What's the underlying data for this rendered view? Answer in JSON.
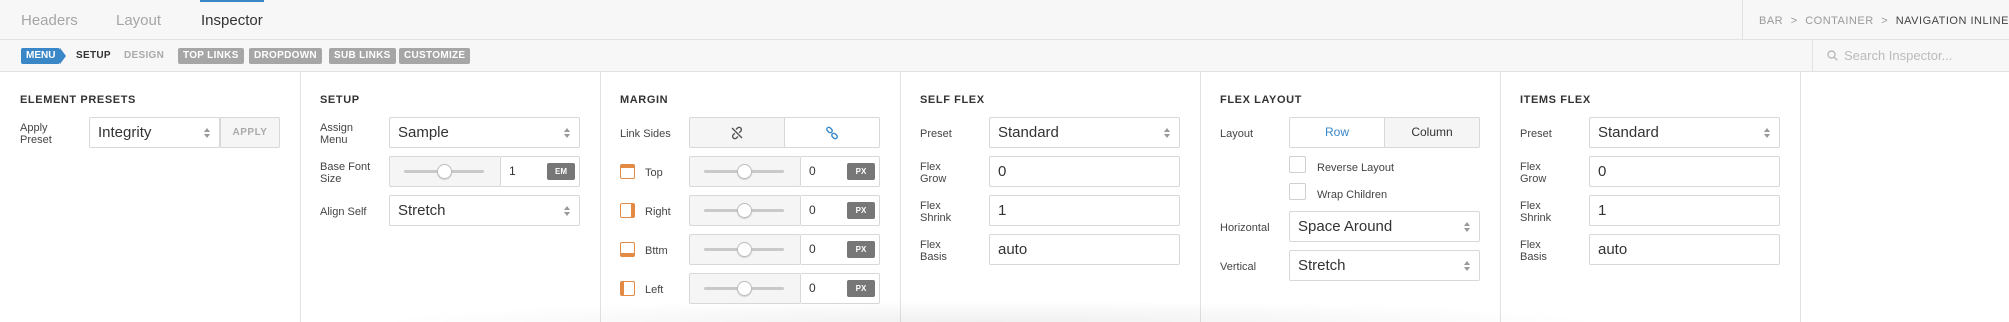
{
  "tabs": [
    "Headers",
    "Layout",
    "Inspector"
  ],
  "breadcrumb": {
    "items": [
      "BAR",
      "CONTAINER",
      "NAVIGATION INLINE"
    ],
    "sep": ">"
  },
  "subnav": {
    "menu": "MENU",
    "setup": "SETUP",
    "design": "DESIGN",
    "tags": [
      "TOP LINKS",
      "DROPDOWN",
      "SUB LINKS",
      "CUSTOMIZE"
    ]
  },
  "search": {
    "placeholder": "Search Inspector..."
  },
  "element_presets": {
    "title": "ELEMENT PRESETS",
    "apply_label": "Apply\nPreset",
    "preset_value": "Integrity",
    "apply_button": "APPLY"
  },
  "setup": {
    "title": "SETUP",
    "assign_menu_label": "Assign\nMenu",
    "assign_menu_value": "Sample",
    "base_font_label": "Base Font\nSize",
    "base_font_value": "1",
    "base_font_unit": "EM",
    "base_font_slider": 0.5,
    "align_self_label": "Align Self",
    "align_self_value": "Stretch"
  },
  "margin": {
    "title": "MARGIN",
    "link_sides_label": "Link Sides",
    "sides": [
      {
        "label": "Top",
        "value": "0",
        "unit": "PX",
        "slider": 0.5
      },
      {
        "label": "Right",
        "value": "0",
        "unit": "PX",
        "slider": 0.5
      },
      {
        "label": "Bttm",
        "value": "0",
        "unit": "PX",
        "slider": 0.5
      },
      {
        "label": "Left",
        "value": "0",
        "unit": "PX",
        "slider": 0.5
      }
    ]
  },
  "self_flex": {
    "title": "SELF FLEX",
    "preset_label": "Preset",
    "preset_value": "Standard",
    "grow_label": "Flex\nGrow",
    "grow_value": "0",
    "shrink_label": "Flex\nShrink",
    "shrink_value": "1",
    "basis_label": "Flex\nBasis",
    "basis_value": "auto"
  },
  "flex_layout": {
    "title": "FLEX LAYOUT",
    "layout_label": "Layout",
    "row": "Row",
    "column": "Column",
    "reverse": "Reverse Layout",
    "wrap": "Wrap Children",
    "horizontal_label": "Horizontal",
    "horizontal_value": "Space Around",
    "vertical_label": "Vertical",
    "vertical_value": "Stretch"
  },
  "items_flex": {
    "title": "ITEMS FLEX",
    "preset_label": "Preset",
    "preset_value": "Standard",
    "grow_label": "Flex\nGrow",
    "grow_value": "0",
    "shrink_label": "Flex\nShrink",
    "shrink_value": "1",
    "basis_label": "Flex\nBasis",
    "basis_value": "auto"
  },
  "colors": {
    "accent": "#3a87c8",
    "muted": "#a6a6a6",
    "unit_bg": "#777777",
    "side_icon": "#e38a44"
  }
}
